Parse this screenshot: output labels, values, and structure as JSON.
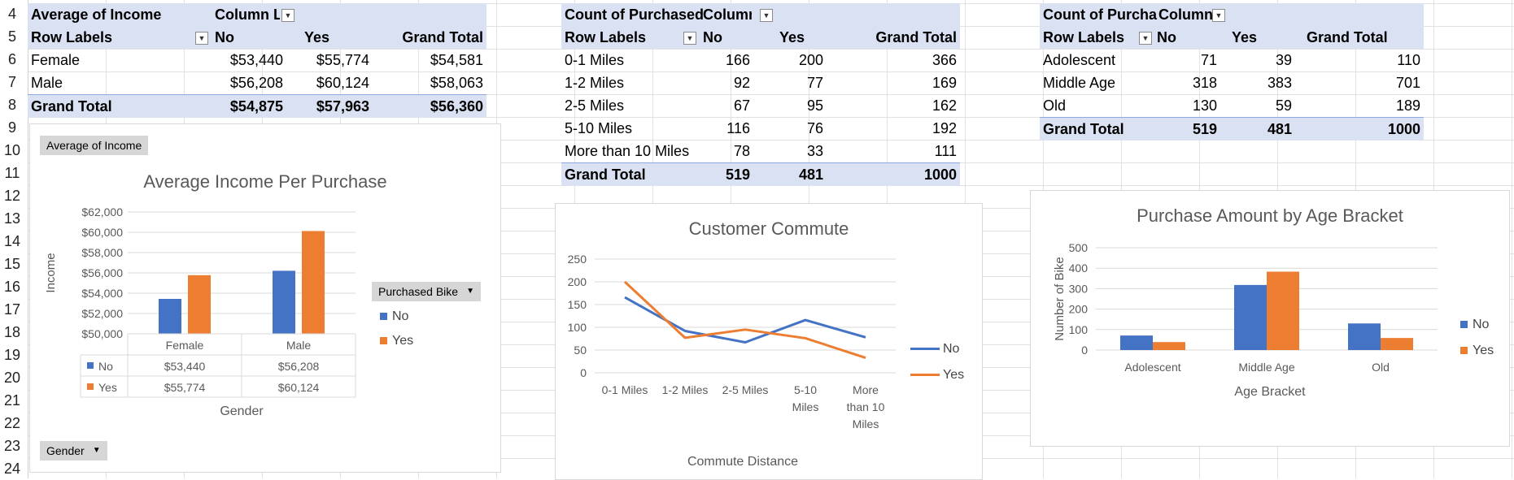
{
  "colors": {
    "no": "#4472c4",
    "yes": "#ed7d31",
    "band": "#d9e1f2"
  },
  "row_numbers": [
    "4",
    "5",
    "6",
    "7",
    "8",
    "9",
    "10",
    "11",
    "12",
    "13",
    "14",
    "15",
    "16",
    "17",
    "18",
    "19",
    "20",
    "21",
    "22",
    "23",
    "24"
  ],
  "pivot1": {
    "title": "Average of Income",
    "col_header": "Column La",
    "row_labels": "Row Labels",
    "cols": [
      "No",
      "Yes",
      "Grand Total"
    ],
    "rows": [
      {
        "label": "Female",
        "values": [
          "$53,440",
          "$55,774",
          "$54,581"
        ]
      },
      {
        "label": "Male",
        "values": [
          "$56,208",
          "$60,124",
          "$58,063"
        ]
      }
    ],
    "total": {
      "label": "Grand Total",
      "values": [
        "$54,875",
        "$57,963",
        "$56,360"
      ]
    }
  },
  "pivot2": {
    "title": "Count of Purchased",
    "col_header": "Column",
    "row_labels": "Row Labels",
    "cols": [
      "No",
      "Yes",
      "Grand Total"
    ],
    "rows": [
      {
        "label": "0-1 Miles",
        "values": [
          "166",
          "200",
          "366"
        ]
      },
      {
        "label": "1-2 Miles",
        "values": [
          "92",
          "77",
          "169"
        ]
      },
      {
        "label": "2-5 Miles",
        "values": [
          "67",
          "95",
          "162"
        ]
      },
      {
        "label": "5-10 Miles",
        "values": [
          "116",
          "76",
          "192"
        ]
      },
      {
        "label": "More than 10 Miles",
        "values": [
          "78",
          "33",
          "111"
        ]
      }
    ],
    "total": {
      "label": "Grand Total",
      "values": [
        "519",
        "481",
        "1000"
      ]
    }
  },
  "pivot3": {
    "title": "Count of Purcha",
    "col_header": "Column",
    "row_labels": "Row Labels",
    "cols": [
      "No",
      "Yes",
      "Grand Total"
    ],
    "rows": [
      {
        "label": "Adolescent",
        "values": [
          "71",
          "39",
          "110"
        ]
      },
      {
        "label": "Middle Age",
        "values": [
          "318",
          "383",
          "701"
        ]
      },
      {
        "label": "Old",
        "values": [
          "130",
          "59",
          "189"
        ]
      }
    ],
    "total": {
      "label": "Grand Total",
      "values": [
        "519",
        "481",
        "1000"
      ]
    }
  },
  "chart1_buttons": {
    "value_field": "Average of Income",
    "legend_field": "Purchased Bike",
    "axis_field": "Gender"
  },
  "chart_data": [
    {
      "type": "bar",
      "title": "Average Income Per Purchase",
      "xlabel": "Gender",
      "ylabel": "Income",
      "categories": [
        "Female",
        "Male"
      ],
      "series": [
        {
          "name": "No",
          "values": [
            53440,
            56208
          ]
        },
        {
          "name": "Yes",
          "values": [
            55774,
            60124
          ]
        }
      ],
      "ylim": [
        50000,
        62000
      ],
      "yticks": [
        "$50,000",
        "$52,000",
        "$54,000",
        "$56,000",
        "$58,000",
        "$60,000",
        "$62,000"
      ],
      "table": {
        "No": [
          "$53,440",
          "$56,208"
        ],
        "Yes": [
          "$55,774",
          "$60,124"
        ]
      },
      "legend": "right",
      "grid": true
    },
    {
      "type": "line",
      "title": "Customer Commute",
      "xlabel": "Commute Distance",
      "ylabel": "",
      "categories": [
        "0-1 Miles",
        "1-2 Miles",
        "2-5 Miles",
        "5-10 Miles",
        "More than 10 Miles"
      ],
      "category_lines": [
        [
          "0-1 Miles"
        ],
        [
          "1-2 Miles"
        ],
        [
          "2-5 Miles"
        ],
        [
          "5-10",
          "Miles"
        ],
        [
          "More",
          "than 10",
          "Miles"
        ]
      ],
      "series": [
        {
          "name": "No",
          "values": [
            166,
            92,
            67,
            116,
            78
          ]
        },
        {
          "name": "Yes",
          "values": [
            200,
            77,
            95,
            76,
            33
          ]
        }
      ],
      "ylim": [
        0,
        250
      ],
      "yticks": [
        "0",
        "50",
        "100",
        "150",
        "200",
        "250"
      ],
      "legend": "right",
      "grid": true
    },
    {
      "type": "bar",
      "title": "Purchase Amount by Age Bracket",
      "xlabel": "Age Bracket",
      "ylabel": "Number of Bike",
      "categories": [
        "Adolescent",
        "Middle Age",
        "Old"
      ],
      "series": [
        {
          "name": "No",
          "values": [
            71,
            318,
            130
          ]
        },
        {
          "name": "Yes",
          "values": [
            39,
            383,
            59
          ]
        }
      ],
      "ylim": [
        0,
        500
      ],
      "yticks": [
        "0",
        "100",
        "200",
        "300",
        "400",
        "500"
      ],
      "legend": "right",
      "grid": true
    }
  ]
}
